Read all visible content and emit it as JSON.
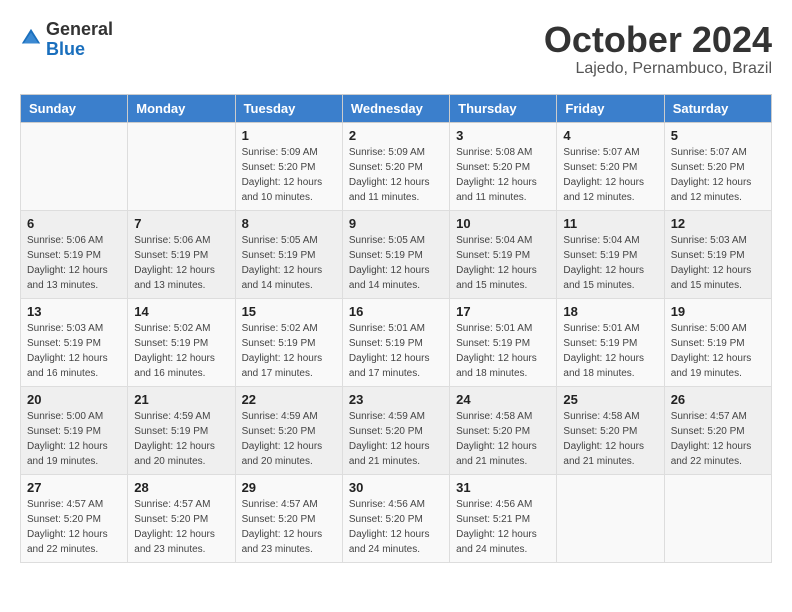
{
  "logo": {
    "general": "General",
    "blue": "Blue"
  },
  "title": "October 2024",
  "subtitle": "Lajedo, Pernambuco, Brazil",
  "days_of_week": [
    "Sunday",
    "Monday",
    "Tuesday",
    "Wednesday",
    "Thursday",
    "Friday",
    "Saturday"
  ],
  "weeks": [
    [
      {
        "day": "",
        "sunrise": "",
        "sunset": "",
        "daylight": ""
      },
      {
        "day": "",
        "sunrise": "",
        "sunset": "",
        "daylight": ""
      },
      {
        "day": "1",
        "sunrise": "Sunrise: 5:09 AM",
        "sunset": "Sunset: 5:20 PM",
        "daylight": "Daylight: 12 hours and 10 minutes."
      },
      {
        "day": "2",
        "sunrise": "Sunrise: 5:09 AM",
        "sunset": "Sunset: 5:20 PM",
        "daylight": "Daylight: 12 hours and 11 minutes."
      },
      {
        "day": "3",
        "sunrise": "Sunrise: 5:08 AM",
        "sunset": "Sunset: 5:20 PM",
        "daylight": "Daylight: 12 hours and 11 minutes."
      },
      {
        "day": "4",
        "sunrise": "Sunrise: 5:07 AM",
        "sunset": "Sunset: 5:20 PM",
        "daylight": "Daylight: 12 hours and 12 minutes."
      },
      {
        "day": "5",
        "sunrise": "Sunrise: 5:07 AM",
        "sunset": "Sunset: 5:20 PM",
        "daylight": "Daylight: 12 hours and 12 minutes."
      }
    ],
    [
      {
        "day": "6",
        "sunrise": "Sunrise: 5:06 AM",
        "sunset": "Sunset: 5:19 PM",
        "daylight": "Daylight: 12 hours and 13 minutes."
      },
      {
        "day": "7",
        "sunrise": "Sunrise: 5:06 AM",
        "sunset": "Sunset: 5:19 PM",
        "daylight": "Daylight: 12 hours and 13 minutes."
      },
      {
        "day": "8",
        "sunrise": "Sunrise: 5:05 AM",
        "sunset": "Sunset: 5:19 PM",
        "daylight": "Daylight: 12 hours and 14 minutes."
      },
      {
        "day": "9",
        "sunrise": "Sunrise: 5:05 AM",
        "sunset": "Sunset: 5:19 PM",
        "daylight": "Daylight: 12 hours and 14 minutes."
      },
      {
        "day": "10",
        "sunrise": "Sunrise: 5:04 AM",
        "sunset": "Sunset: 5:19 PM",
        "daylight": "Daylight: 12 hours and 15 minutes."
      },
      {
        "day": "11",
        "sunrise": "Sunrise: 5:04 AM",
        "sunset": "Sunset: 5:19 PM",
        "daylight": "Daylight: 12 hours and 15 minutes."
      },
      {
        "day": "12",
        "sunrise": "Sunrise: 5:03 AM",
        "sunset": "Sunset: 5:19 PM",
        "daylight": "Daylight: 12 hours and 15 minutes."
      }
    ],
    [
      {
        "day": "13",
        "sunrise": "Sunrise: 5:03 AM",
        "sunset": "Sunset: 5:19 PM",
        "daylight": "Daylight: 12 hours and 16 minutes."
      },
      {
        "day": "14",
        "sunrise": "Sunrise: 5:02 AM",
        "sunset": "Sunset: 5:19 PM",
        "daylight": "Daylight: 12 hours and 16 minutes."
      },
      {
        "day": "15",
        "sunrise": "Sunrise: 5:02 AM",
        "sunset": "Sunset: 5:19 PM",
        "daylight": "Daylight: 12 hours and 17 minutes."
      },
      {
        "day": "16",
        "sunrise": "Sunrise: 5:01 AM",
        "sunset": "Sunset: 5:19 PM",
        "daylight": "Daylight: 12 hours and 17 minutes."
      },
      {
        "day": "17",
        "sunrise": "Sunrise: 5:01 AM",
        "sunset": "Sunset: 5:19 PM",
        "daylight": "Daylight: 12 hours and 18 minutes."
      },
      {
        "day": "18",
        "sunrise": "Sunrise: 5:01 AM",
        "sunset": "Sunset: 5:19 PM",
        "daylight": "Daylight: 12 hours and 18 minutes."
      },
      {
        "day": "19",
        "sunrise": "Sunrise: 5:00 AM",
        "sunset": "Sunset: 5:19 PM",
        "daylight": "Daylight: 12 hours and 19 minutes."
      }
    ],
    [
      {
        "day": "20",
        "sunrise": "Sunrise: 5:00 AM",
        "sunset": "Sunset: 5:19 PM",
        "daylight": "Daylight: 12 hours and 19 minutes."
      },
      {
        "day": "21",
        "sunrise": "Sunrise: 4:59 AM",
        "sunset": "Sunset: 5:19 PM",
        "daylight": "Daylight: 12 hours and 20 minutes."
      },
      {
        "day": "22",
        "sunrise": "Sunrise: 4:59 AM",
        "sunset": "Sunset: 5:20 PM",
        "daylight": "Daylight: 12 hours and 20 minutes."
      },
      {
        "day": "23",
        "sunrise": "Sunrise: 4:59 AM",
        "sunset": "Sunset: 5:20 PM",
        "daylight": "Daylight: 12 hours and 21 minutes."
      },
      {
        "day": "24",
        "sunrise": "Sunrise: 4:58 AM",
        "sunset": "Sunset: 5:20 PM",
        "daylight": "Daylight: 12 hours and 21 minutes."
      },
      {
        "day": "25",
        "sunrise": "Sunrise: 4:58 AM",
        "sunset": "Sunset: 5:20 PM",
        "daylight": "Daylight: 12 hours and 21 minutes."
      },
      {
        "day": "26",
        "sunrise": "Sunrise: 4:57 AM",
        "sunset": "Sunset: 5:20 PM",
        "daylight": "Daylight: 12 hours and 22 minutes."
      }
    ],
    [
      {
        "day": "27",
        "sunrise": "Sunrise: 4:57 AM",
        "sunset": "Sunset: 5:20 PM",
        "daylight": "Daylight: 12 hours and 22 minutes."
      },
      {
        "day": "28",
        "sunrise": "Sunrise: 4:57 AM",
        "sunset": "Sunset: 5:20 PM",
        "daylight": "Daylight: 12 hours and 23 minutes."
      },
      {
        "day": "29",
        "sunrise": "Sunrise: 4:57 AM",
        "sunset": "Sunset: 5:20 PM",
        "daylight": "Daylight: 12 hours and 23 minutes."
      },
      {
        "day": "30",
        "sunrise": "Sunrise: 4:56 AM",
        "sunset": "Sunset: 5:20 PM",
        "daylight": "Daylight: 12 hours and 24 minutes."
      },
      {
        "day": "31",
        "sunrise": "Sunrise: 4:56 AM",
        "sunset": "Sunset: 5:21 PM",
        "daylight": "Daylight: 12 hours and 24 minutes."
      },
      {
        "day": "",
        "sunrise": "",
        "sunset": "",
        "daylight": ""
      },
      {
        "day": "",
        "sunrise": "",
        "sunset": "",
        "daylight": ""
      }
    ]
  ]
}
